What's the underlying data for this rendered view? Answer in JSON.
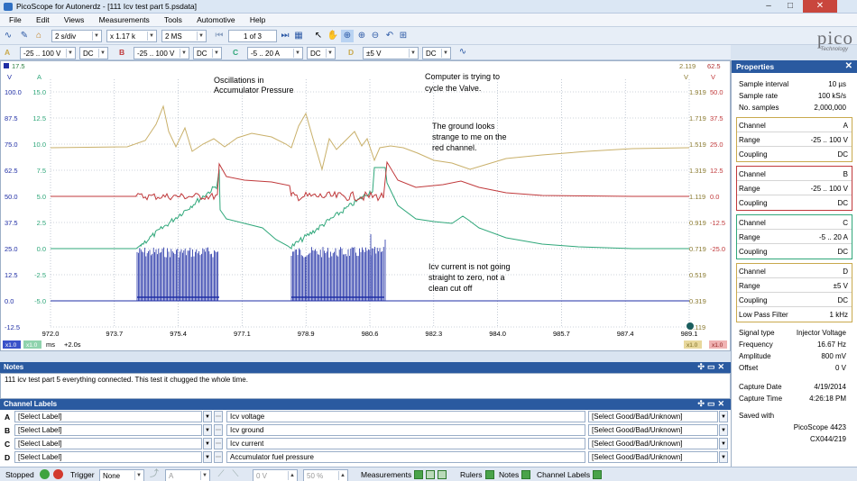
{
  "window": {
    "title": "PicoScope for Autonerdz - [111 Icv test part 5.psdata]",
    "min": "–",
    "max": "□",
    "close": "✕"
  },
  "menu": [
    "File",
    "Edit",
    "Views",
    "Measurements",
    "Tools",
    "Automotive",
    "Help"
  ],
  "toolbar": {
    "timebase": "2 s/div",
    "zoom": "x 1.17 k",
    "samples": "2 MS",
    "page": "1 of 3"
  },
  "logo": {
    "name": "pico",
    "sub": "Technology"
  },
  "channels": [
    {
      "id": "A",
      "range": "-25 .. 100 V",
      "coupling": "DC",
      "color": "#c9a94d"
    },
    {
      "id": "B",
      "range": "-25 .. 100 V",
      "coupling": "DC",
      "color": "#c0393b"
    },
    {
      "id": "C",
      "range": "-5 .. 20 A",
      "coupling": "DC",
      "color": "#2fa77a"
    },
    {
      "id": "D",
      "range": "±5 V",
      "coupling": "DC",
      "color": "#1f2ea5"
    }
  ],
  "scope": {
    "axis_top_left_a": "17.5",
    "axis_top_right_d": "2.119",
    "axis_top_right_c": "62.5",
    "unit_v": "V",
    "unit_a": "A",
    "left_axis_v": [
      "100.0",
      "87.5",
      "75.0",
      "62.5",
      "50.0",
      "37.5",
      "25.0",
      "12.5",
      "0.0",
      "-12.5"
    ],
    "left_axis_a": [
      "15.0",
      "12.5",
      "10.0",
      "7.5",
      "5.0",
      "2.5",
      "0.0",
      "-2.5",
      "-5.0"
    ],
    "right_axis_d": [
      "1.919",
      "1.719",
      "1.519",
      "1.319",
      "1.119",
      "0.919",
      "0.719",
      "0.519",
      "0.319",
      "0.119"
    ],
    "right_axis_b": [
      "50.0",
      "37.5",
      "25.0",
      "12.5",
      "0.0",
      "-12.5",
      "-25.0"
    ],
    "x_ticks": [
      "972.0",
      "973.7",
      "975.4",
      "977.1",
      "978.9",
      "980.6",
      "982.3",
      "984.0",
      "985.7",
      "987.4",
      "989.1"
    ],
    "x_unit": "ms",
    "x_offset": "+2.0s",
    "scale_left_v": "x1.0",
    "scale_left_a": "x1.0",
    "scale_right_b": "x1.0",
    "scale_right_d": "x1.0",
    "annotations": [
      "Oscillations in\nAccumulator Pressure",
      "Computer is trying to\ncycle the Valve.",
      "The ground looks\nstrange to me on the\nred channel.",
      "Icv current is not going\nstraight to zero, not a\nclean cut off"
    ]
  },
  "properties": {
    "title": "Properties",
    "general": [
      {
        "k": "Sample interval",
        "v": "10 µs"
      },
      {
        "k": "Sample rate",
        "v": "100 kS/s"
      },
      {
        "k": "No. samples",
        "v": "2,000,000"
      }
    ],
    "channel_boxes": [
      [
        {
          "k": "Channel",
          "v": "A"
        },
        {
          "k": "Range",
          "v": "-25 .. 100 V"
        },
        {
          "k": "Coupling",
          "v": "DC"
        }
      ],
      [
        {
          "k": "Channel",
          "v": "B"
        },
        {
          "k": "Range",
          "v": "-25 .. 100 V"
        },
        {
          "k": "Coupling",
          "v": "DC"
        }
      ],
      [
        {
          "k": "Channel",
          "v": "C"
        },
        {
          "k": "Range",
          "v": "-5 .. 20 A"
        },
        {
          "k": "Coupling",
          "v": "DC"
        }
      ],
      [
        {
          "k": "Channel",
          "v": "D"
        },
        {
          "k": "Range",
          "v": "±5 V"
        },
        {
          "k": "Coupling",
          "v": "DC"
        },
        {
          "k": "Low Pass Filter",
          "v": "1 kHz"
        }
      ]
    ],
    "signal": [
      {
        "k": "Signal type",
        "v": "Injector Voltage"
      },
      {
        "k": "Frequency",
        "v": "16.67 Hz"
      },
      {
        "k": "Amplitude",
        "v": "800 mV"
      },
      {
        "k": "Offset",
        "v": "0 V"
      }
    ],
    "capture": [
      {
        "k": "Capture Date",
        "v": "4/19/2014"
      },
      {
        "k": "Capture Time",
        "v": "4:26:18 PM"
      }
    ],
    "saved_with_label": "Saved with",
    "saved_with": [
      "PicoScope 4423",
      "CX044/219"
    ]
  },
  "notes": {
    "title": "Notes",
    "text": "111 icv test part 5 everything connected.  This test it chugged the whole time."
  },
  "channel_labels": {
    "title": "Channel Labels",
    "rows": [
      {
        "id": "A",
        "select": "[Select Label]",
        "label": "Icv voltage",
        "status": "[Select Good/Bad/Unknown]"
      },
      {
        "id": "B",
        "select": "[Select Label]",
        "label": "Icv ground",
        "status": "[Select Good/Bad/Unknown]"
      },
      {
        "id": "C",
        "select": "[Select Label]",
        "label": "Icv current",
        "status": "[Select Good/Bad/Unknown]"
      },
      {
        "id": "D",
        "select": "[Select Label]",
        "label": "Accumulator fuel pressure",
        "status": "[Select Good/Bad/Unknown]"
      }
    ]
  },
  "status": {
    "state": "Stopped",
    "trigger_label": "Trigger",
    "trigger_value": "None",
    "trigger_channel": "A",
    "trigger_level": "0 V",
    "trigger_pct": "50 %",
    "measurements": "Measurements",
    "rulers": "Rulers",
    "notes": "Notes",
    "channel_labels": "Channel Labels"
  }
}
